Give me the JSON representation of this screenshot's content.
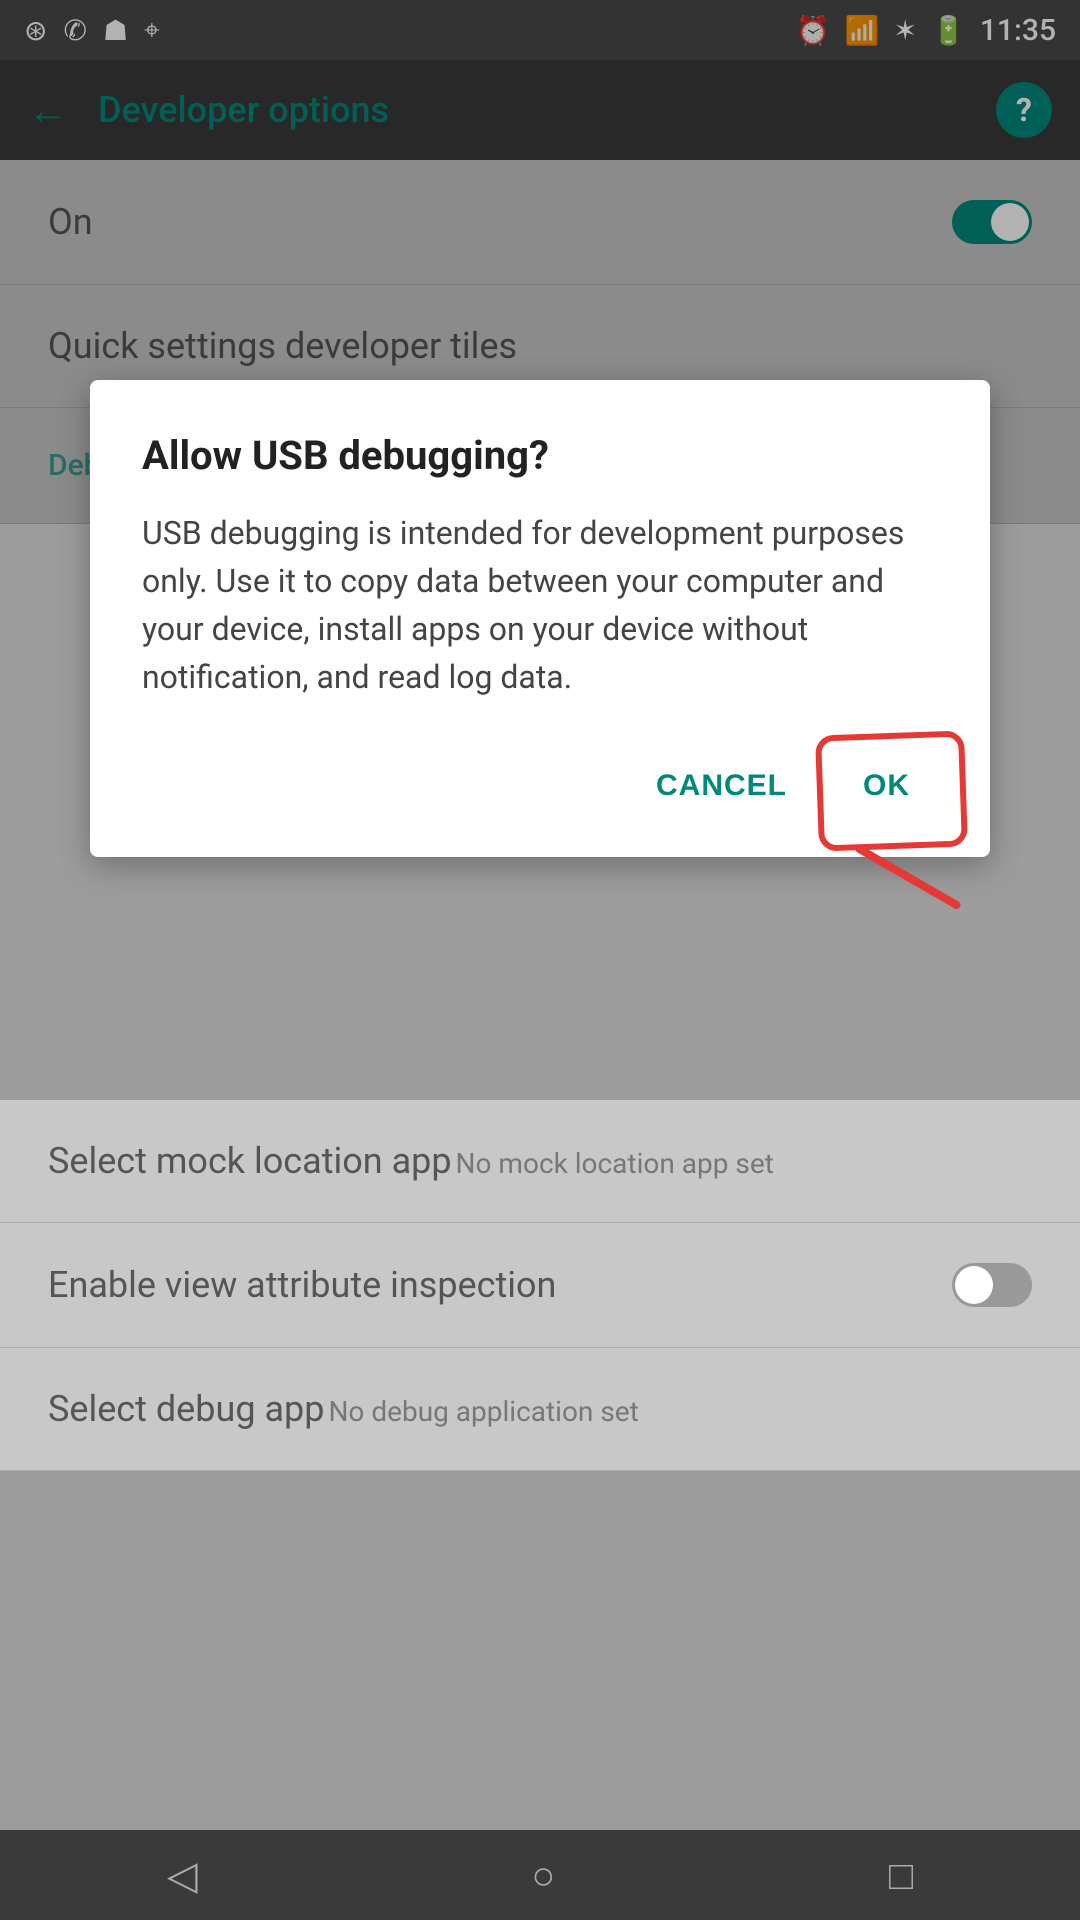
{
  "statusBar": {
    "time": "11:35",
    "leftIcons": [
      "whatsapp-icon",
      "call-icon",
      "image-icon",
      "phone-icon"
    ],
    "rightIcons": [
      "alarm-icon",
      "wifi-icon",
      "signal-icon",
      "battery-icon"
    ]
  },
  "appBar": {
    "title": "Developer options",
    "backLabel": "←",
    "helpLabel": "?"
  },
  "background": {
    "toggleLabel": "On",
    "quickSettingsLabel": "Quick settings developer tiles",
    "debuggingSectionLabel": "Debugging",
    "mockLocationLabel": "Select mock location app",
    "mockLocationSub": "No mock location app set",
    "viewAttributeLabel": "Enable view attribute inspection",
    "debugAppLabel": "Select debug app",
    "debugAppSub": "No debug application set"
  },
  "dialog": {
    "title": "Allow USB debugging?",
    "body": "USB debugging is intended for development purposes only. Use it to copy data between your computer and your device, install apps on your device without notification, and read log data.",
    "cancelLabel": "CANCEL",
    "okLabel": "OK"
  },
  "bottomNav": {
    "backIcon": "◁",
    "homeIcon": "○",
    "recentIcon": "□"
  }
}
